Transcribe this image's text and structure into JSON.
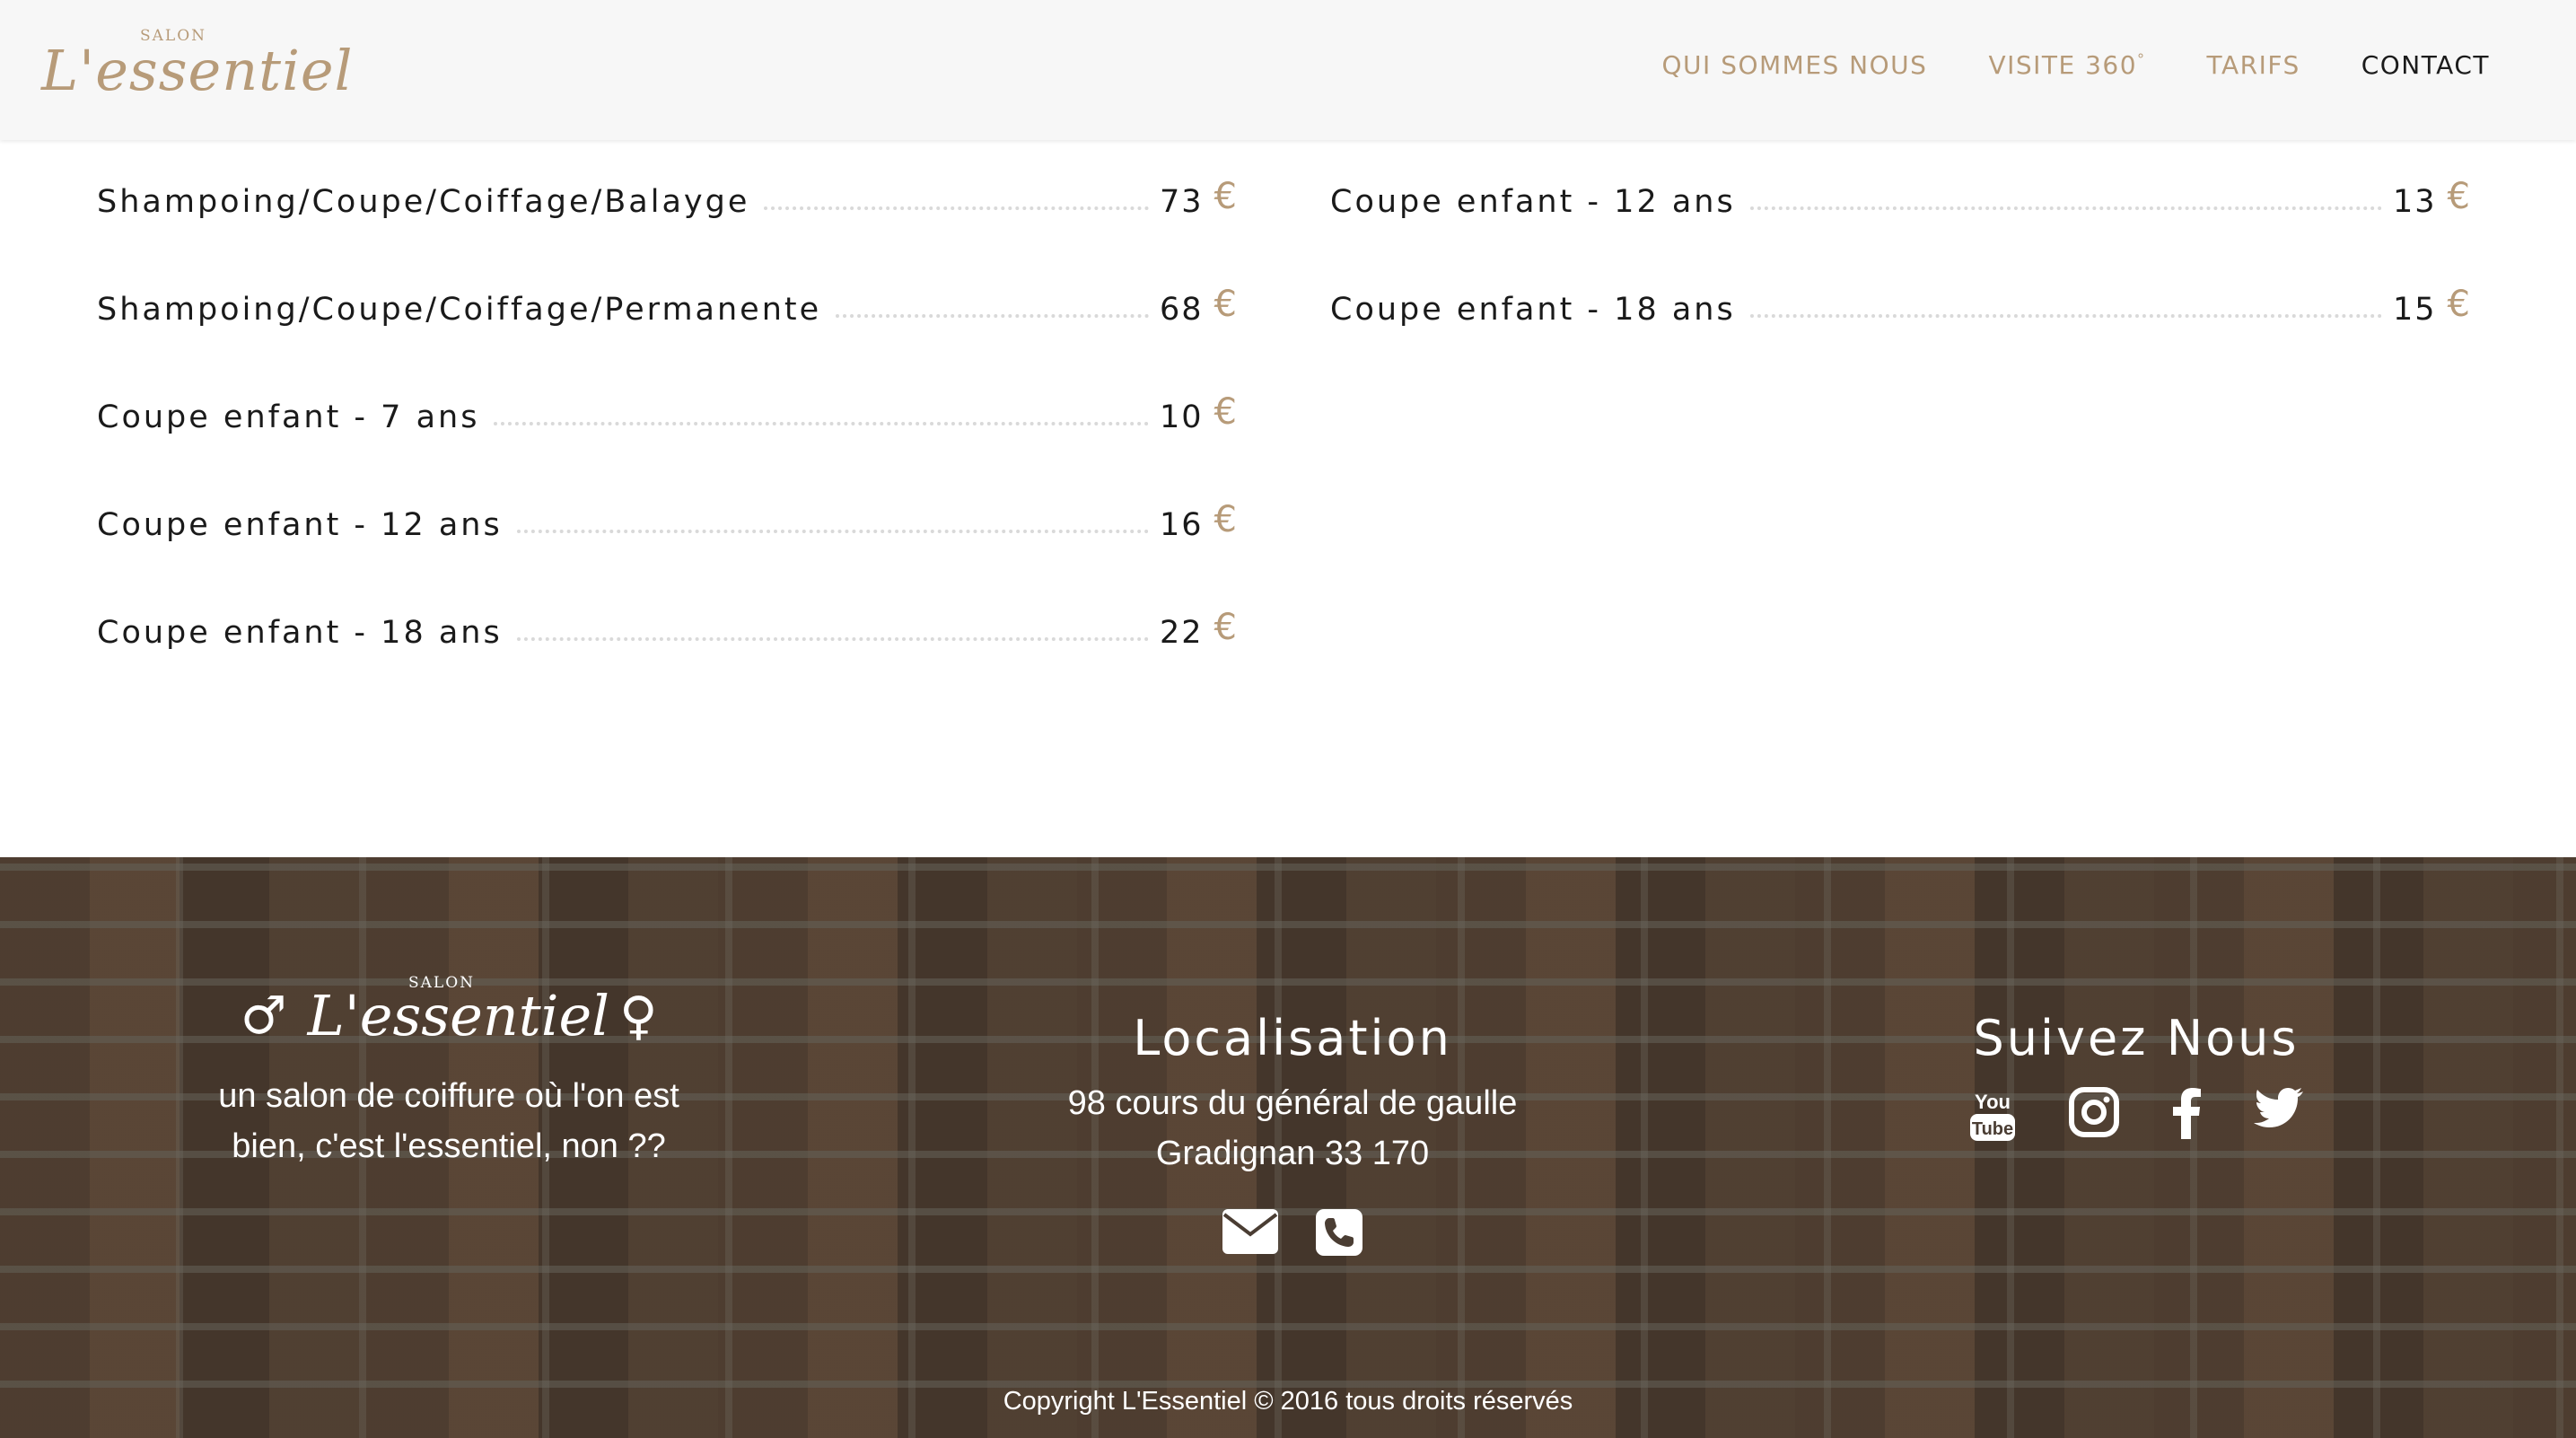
{
  "brand": {
    "salon": "SALON",
    "name": "L'essentiel",
    "color": "#b79b79"
  },
  "nav": {
    "items": [
      {
        "label": "QUI SOMMES NOUS",
        "active": false
      },
      {
        "label": "VISITE 360",
        "sup": "°",
        "active": false
      },
      {
        "label": "TARIFS",
        "active": false
      },
      {
        "label": "CONTACT",
        "active": true
      }
    ]
  },
  "prices": {
    "currency": "€",
    "left": [
      {
        "name": "Shampoing/Coupe/Coiffage/Balayge",
        "value": "73"
      },
      {
        "name": "Shampoing/Coupe/Coiffage/Permanente",
        "value": "68"
      },
      {
        "name": "Coupe enfant - 7 ans",
        "value": "10"
      },
      {
        "name": "Coupe enfant - 12 ans",
        "value": "16"
      },
      {
        "name": "Coupe enfant - 18 ans",
        "value": "22"
      }
    ],
    "right": [
      {
        "name": "Coupe enfant - 12 ans",
        "value": "13"
      },
      {
        "name": "Coupe enfant - 18 ans",
        "value": "15"
      }
    ]
  },
  "footer": {
    "logo": {
      "male_symbol": "♂",
      "salon": "SALON",
      "name": "L'essentiel",
      "female_symbol": "♀"
    },
    "tagline_line1": "un salon de coiffure où l'on est",
    "tagline_line2": "bien, c'est l'essentiel, non ??",
    "location": {
      "heading": "Localisation",
      "address_line1": "98 cours du général de gaulle",
      "address_line2": "Gradignan 33 170",
      "icons": [
        "envelope-icon",
        "phone-icon"
      ]
    },
    "social": {
      "heading": "Suivez Nous",
      "icons": [
        "youtube-icon",
        "instagram-icon",
        "facebook-icon",
        "twitter-icon"
      ],
      "youtube_top": "You",
      "youtube_bottom": "Tube"
    },
    "copyright": "Copyright L'Essentiel © 2016 tous droits réservés"
  }
}
